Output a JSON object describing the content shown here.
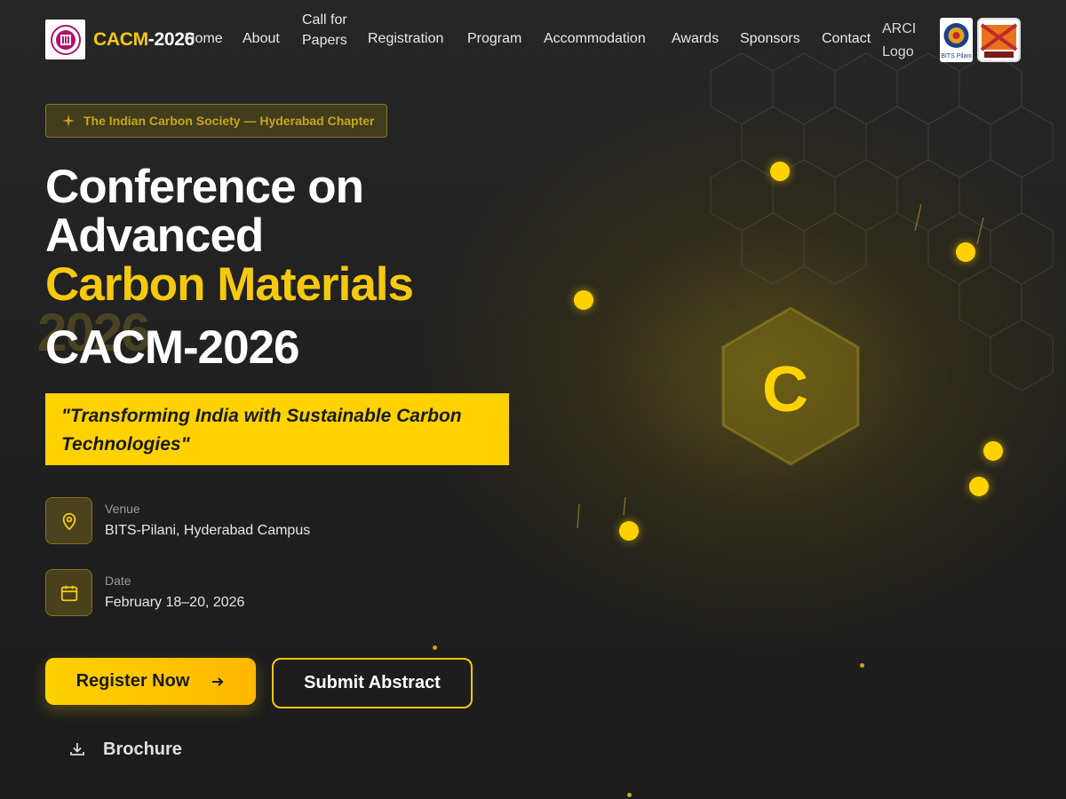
{
  "nav": {
    "brand_part1": "CACM",
    "brand_part2": "-2026",
    "items": [
      {
        "label": "Home"
      },
      {
        "label": "About"
      },
      {
        "label": "Call for Papers"
      },
      {
        "label": "Registration"
      },
      {
        "label": "Program"
      },
      {
        "label": "Accommodation"
      },
      {
        "label": "Awards"
      },
      {
        "label": "Sponsors"
      },
      {
        "label": "Contact"
      }
    ],
    "partners": {
      "arci_alt": "ARCI Logo",
      "bits_label": "BITS Pilani",
      "birla_label": "BIRLA CARBON"
    }
  },
  "hero": {
    "badge": "The Indian Carbon Society — Hyderabad Chapter",
    "title_line1": "Conference on",
    "title_line2": "Advanced",
    "title_line3": "Carbon Materials",
    "ghost_year": "2026",
    "acronym": "CACM-2026",
    "tagline": "\"Transforming India with Sustainable Carbon Technologies\"",
    "venue_label": "Venue",
    "venue_value": "BITS-Pilani, Hyderabad Campus",
    "date_label": "Date",
    "date_value": "February 18–20, 2026",
    "register_label": "Register Now",
    "abstract_label": "Submit Abstract",
    "brochure_label": "Brochure",
    "carbon_symbol": "C"
  },
  "colors": {
    "accent": "#ffd200",
    "background": "#1e1e1e",
    "badge_text": "#c9a51c"
  },
  "icons": {
    "badge": "sparkle-icon",
    "venue": "map-pin-icon",
    "date": "calendar-icon",
    "register": "arrow-right-icon",
    "brochure": "download-icon"
  }
}
